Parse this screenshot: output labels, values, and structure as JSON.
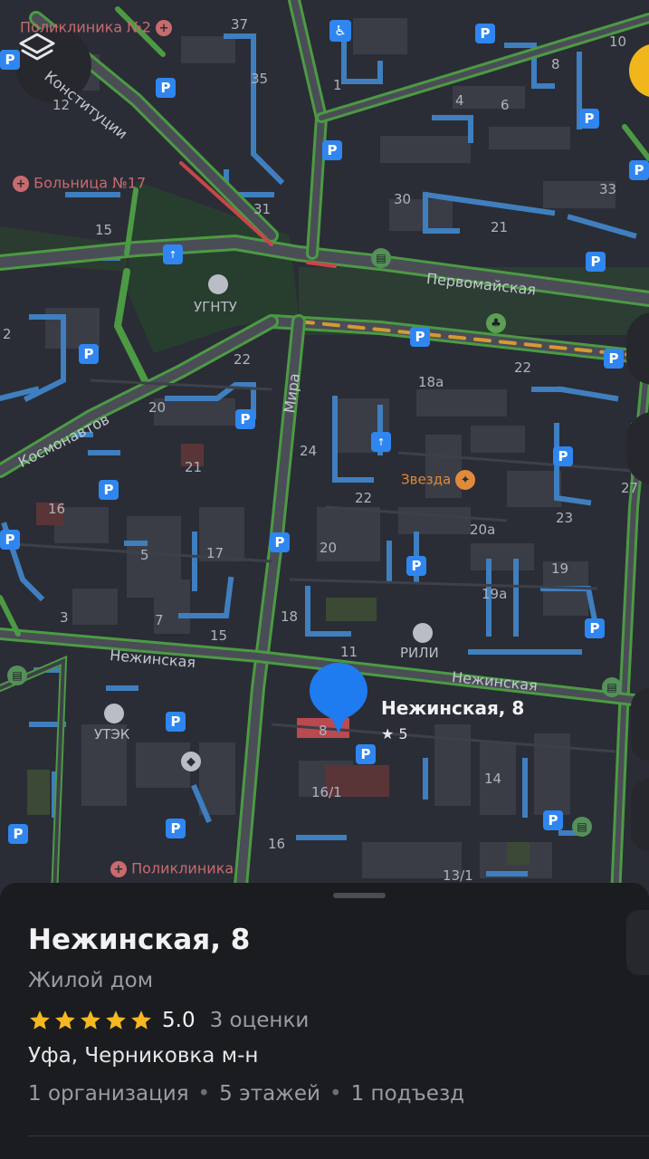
{
  "map": {
    "streets": {
      "konstitutsii": "Конституции",
      "pervomayskaya": "Первомайская",
      "kosmonavtov": "Космонавтов",
      "mira": "Мира",
      "nezhinskaya_west": "Нежинская",
      "nezhinskaya_east": "Нежинская"
    },
    "pois": {
      "poliklinika_2": "Поликлиника №2",
      "bolnitsa_17": "Больница №17",
      "ugntu": "УГНТУ",
      "zvezda": "Звезда",
      "rili": "РИЛИ",
      "utek": "УТЭК",
      "poliklinika": "Поликлиника"
    },
    "house_numbers": [
      "37",
      "35",
      "1",
      "4",
      "6",
      "8",
      "10",
      "12",
      "30",
      "21",
      "33",
      "31",
      "15",
      "2",
      "22",
      "18а",
      "22",
      "20",
      "24",
      "21",
      "22",
      "27",
      "16",
      "5",
      "17",
      "20",
      "20а",
      "23",
      "19",
      "19а",
      "3",
      "7",
      "15",
      "18",
      "11",
      "8",
      "16/1",
      "14",
      "16",
      "13/1"
    ],
    "parking_label": "P",
    "selected": {
      "label": "Нежинская, 8",
      "rating": "★ 5",
      "number": "8"
    }
  },
  "sheet": {
    "title": "Нежинская, 8",
    "type": "Жилой дом",
    "rating_value": "5.0",
    "rating_stars": 5,
    "rating_count": "3 оценки",
    "address": "Уфа, Черниковка м-н",
    "details": [
      "1 организация",
      "5 этажей",
      "1 подъезд"
    ]
  },
  "colors": {
    "map_background": "#2a2d35",
    "road_green": "#4c9a44",
    "building_blue": "#3f7fbf",
    "parking_blue": "#2f86f0",
    "pin_blue": "#1e7bf0",
    "star_yellow": "#f5b820",
    "accent_yellow": "#f1b61b"
  },
  "icons": [
    "layers-icon",
    "parking-icon",
    "hospital-icon",
    "university-icon",
    "fitness-icon",
    "shop-icon",
    "bus-stop-icon",
    "park-icon",
    "accessibility-icon",
    "location-pin-icon",
    "star-icon"
  ]
}
